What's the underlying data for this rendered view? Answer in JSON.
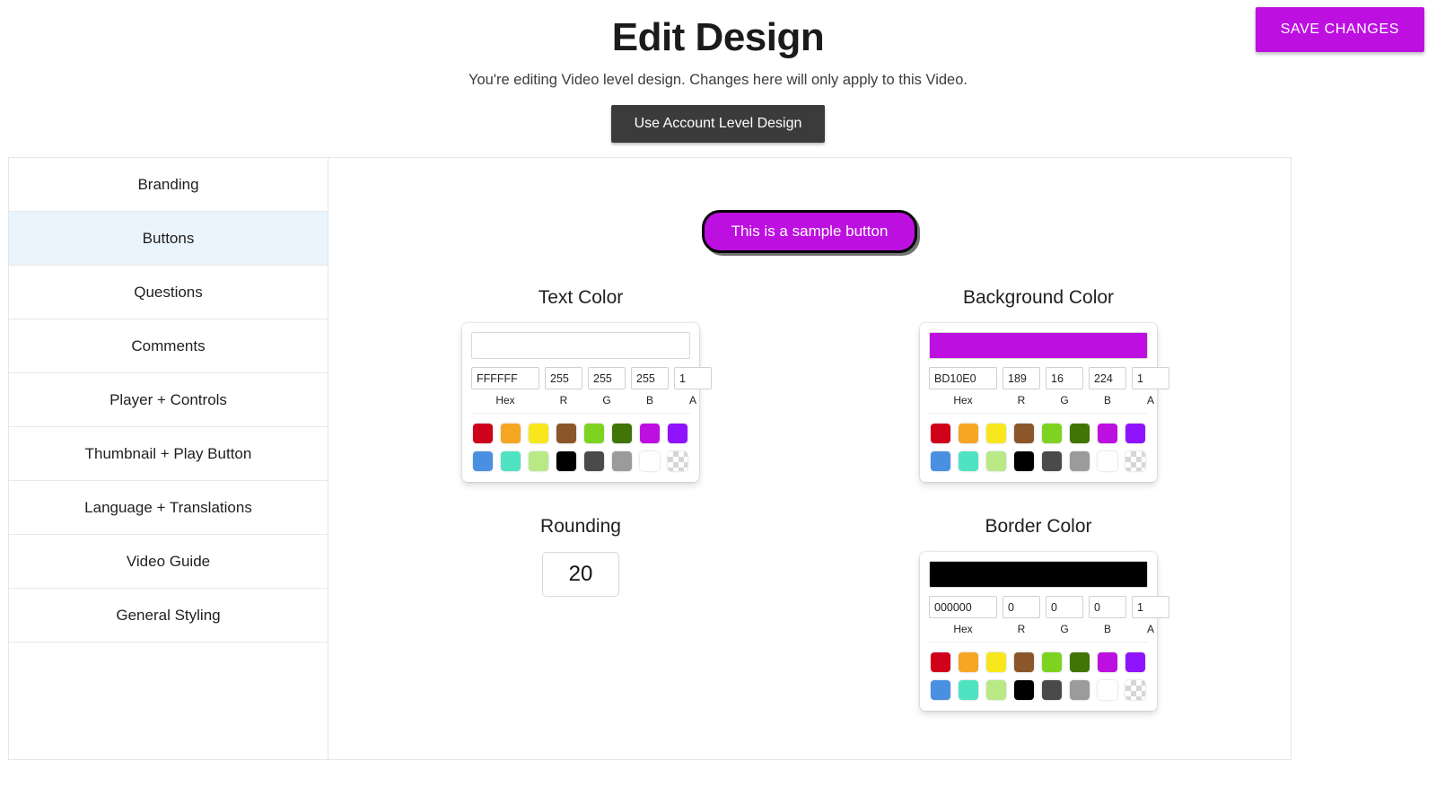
{
  "header": {
    "title": "Edit Design",
    "subtitle": "You're editing Video level design. Changes here will only apply to this Video.",
    "account_level_button": "Use Account Level Design",
    "save_button": "SAVE CHANGES",
    "save_button_color": "#BD10E0"
  },
  "sidebar": {
    "items": [
      {
        "label": "Branding",
        "active": false
      },
      {
        "label": "Buttons",
        "active": true
      },
      {
        "label": "Questions",
        "active": false
      },
      {
        "label": "Comments",
        "active": false
      },
      {
        "label": "Player + Controls",
        "active": false
      },
      {
        "label": "Thumbnail + Play Button",
        "active": false
      },
      {
        "label": "Language + Translations",
        "active": false
      },
      {
        "label": "Video Guide",
        "active": false
      },
      {
        "label": "General Styling",
        "active": false
      }
    ],
    "active_color": "#eaf4fd"
  },
  "preview": {
    "sample_button_label": "This is a sample button",
    "sample_button_bg": "#BD10E0",
    "sample_button_text_color": "#FFFFFF",
    "sample_button_border_color": "#000000",
    "sample_button_rounding": "20"
  },
  "palette": {
    "row1": [
      "#D0021B",
      "#F5A623",
      "#F8E71C",
      "#8B572A",
      "#7ED321",
      "#417505",
      "#BD10E0",
      "#9013FE"
    ],
    "row2": [
      "#4A90E2",
      "#50E3C2",
      "#B8E986",
      "#000000",
      "#4A4A4A",
      "#9B9B9B",
      "#FFFFFF",
      "transparent"
    ]
  },
  "field_labels": {
    "hex": "Hex",
    "r": "R",
    "g": "G",
    "b": "B",
    "a": "A"
  },
  "sections": {
    "text_color": {
      "label": "Text Color",
      "preview_color": "#FFFFFF",
      "hex": "FFFFFF",
      "r": "255",
      "g": "255",
      "b": "255",
      "a": "1"
    },
    "background_color": {
      "label": "Background Color",
      "preview_color": "#BD10E0",
      "hex": "BD10E0",
      "r": "189",
      "g": "16",
      "b": "224",
      "a": "1"
    },
    "rounding": {
      "label": "Rounding",
      "value": "20"
    },
    "border_color": {
      "label": "Border Color",
      "preview_color": "#000000",
      "hex": "000000",
      "r": "0",
      "g": "0",
      "b": "0",
      "a": "1"
    }
  }
}
